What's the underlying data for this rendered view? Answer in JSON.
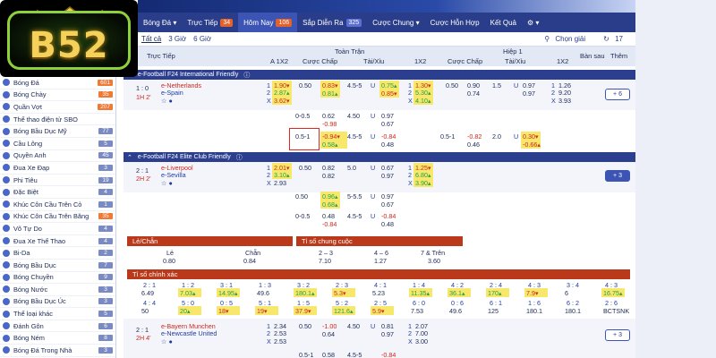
{
  "logo": {
    "text": "B52"
  },
  "topnav": {
    "items": [
      {
        "label": "Bóng Đá ▾",
        "badge": ""
      },
      {
        "label": "Trực Tiếp",
        "badge": "34"
      },
      {
        "label": "Hôm Nay",
        "badge": "106"
      },
      {
        "label": "Sắp Diễn Ra",
        "badge": "325"
      },
      {
        "label": "Cược Chung ▾",
        "badge": ""
      },
      {
        "label": "Cược Hỗn Hợp",
        "badge": ""
      },
      {
        "label": "Kết Quả",
        "badge": ""
      },
      {
        "label": "⚙ ▾",
        "badge": ""
      }
    ]
  },
  "subnav": {
    "tabs": [
      "Tất cả",
      "3 Giờ",
      "6 Giờ"
    ],
    "choose_odds": "Chọn giải",
    "count": "17"
  },
  "sidebar": {
    "items": [
      {
        "label": "Bóng Đá",
        "count": "601",
        "hot": true
      },
      {
        "label": "Bóng Chày",
        "count": "35",
        "hot": true
      },
      {
        "label": "Quần Vợt",
        "count": "207",
        "hot": true
      },
      {
        "label": "Thể thao điện tử SBO",
        "count": "",
        "hot": false
      },
      {
        "label": "Bóng Bầu Dục Mỹ",
        "count": "77",
        "hot": false
      },
      {
        "label": "Cầu Lông",
        "count": "5",
        "hot": false
      },
      {
        "label": "Quyền Anh",
        "count": "45",
        "hot": false
      },
      {
        "label": "Đua Xe Đạp",
        "count": "3",
        "hot": false
      },
      {
        "label": "Phi Tiêu",
        "count": "19",
        "hot": false
      },
      {
        "label": "Đặc Biệt",
        "count": "4",
        "hot": false
      },
      {
        "label": "Khúc Côn Cầu Trên Cỏ",
        "count": "1",
        "hot": false
      },
      {
        "label": "Khúc Côn Cầu Trên Băng",
        "count": "35",
        "hot": true
      },
      {
        "label": "Võ Tự Do",
        "count": "4",
        "hot": false
      },
      {
        "label": "Đua Xe Thể Thao",
        "count": "4",
        "hot": false
      },
      {
        "label": "Bi-Da",
        "count": "2",
        "hot": false
      },
      {
        "label": "Bóng Bầu Dục",
        "count": "7",
        "hot": false
      },
      {
        "label": "Bóng Chuyền",
        "count": "9",
        "hot": false
      },
      {
        "label": "Bóng Nước",
        "count": "3",
        "hot": false
      },
      {
        "label": "Bóng Bầu Dục Úc",
        "count": "3",
        "hot": false
      },
      {
        "label": "Thể loại khác",
        "count": "5",
        "hot": false
      },
      {
        "label": "Đánh Gôn",
        "count": "6",
        "hot": false
      },
      {
        "label": "Bóng Ném",
        "count": "8",
        "hot": false
      },
      {
        "label": "Bóng Đá Trong Nhà",
        "count": "3",
        "hot": false
      }
    ]
  },
  "table": {
    "headers": {
      "live": "Trực Tiếp",
      "full": "Toàn Trận",
      "half": "Hiệp 1",
      "a1x2": "A 1X2",
      "hcap": "Cược Chấp",
      "ou": "Tài/Xỉu",
      "x12": "1X2",
      "hcap2": "Cược Chấp",
      "ou2": "Tài/Xỉu",
      "x12b": "1X2",
      "bansau": "Bàn sau",
      "them": "Thêm"
    },
    "league1": "e-Football F24 International Friendly",
    "league2": "e-Football F24 Elite Club Friendly",
    "match1": {
      "score": "1 : 0",
      "time": "1H 2'",
      "home": "e-Netherlands",
      "away": "e-Spain",
      "more": "+ 6"
    },
    "match2": {
      "score": "2 : 1",
      "time": "2H 2'",
      "home": "e-Liverpool",
      "away": "e-Sevilla",
      "more": "+ 3"
    },
    "match3": {
      "score": "2 : 1",
      "time": "2H 4'",
      "home": "e-Bayern Munchen",
      "away": "e-Newcastle United",
      "more": "+ 3"
    }
  },
  "lechan": {
    "title": "Lẻ/Chẵn",
    "le": "Lẻ",
    "chan": "Chẵn",
    "le_v": "0.80",
    "chan_v": "0.84"
  },
  "tiso": {
    "title": "Tỉ số chung cuộc",
    "c1": "2 – 3",
    "c2": "4 – 6",
    "c3": "7 & Trên",
    "v1": "7.10",
    "v2": "1.27",
    "v3": "3.60"
  },
  "chinhxac": {
    "title": "Tỉ số chính xác"
  },
  "colors": {
    "nav": "#2a3d8a",
    "accent": "#f07a35",
    "highlight": "#f7e86b",
    "panel": "#b9391a"
  }
}
